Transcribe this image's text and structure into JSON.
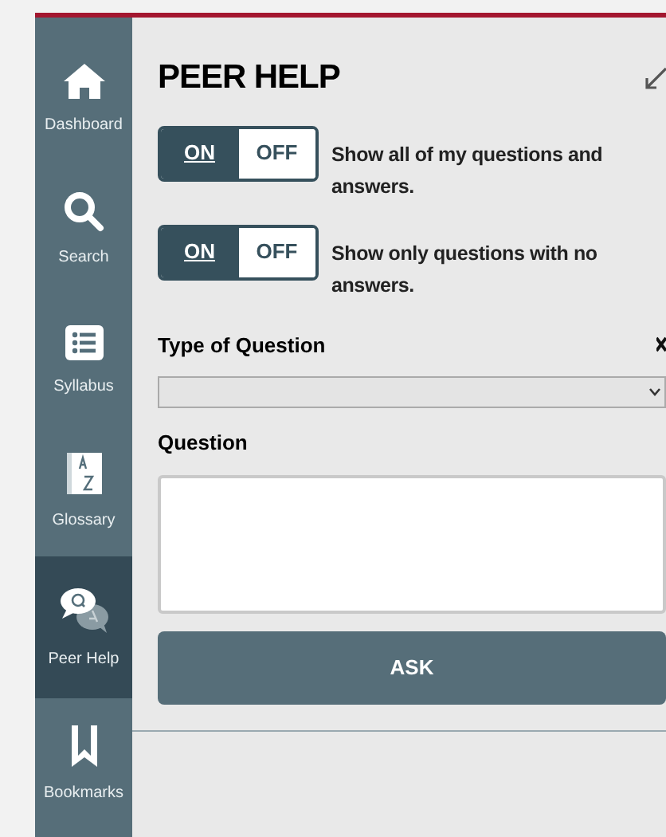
{
  "sidebar": {
    "items": [
      {
        "label": "Dashboard",
        "selected": false
      },
      {
        "label": "Search",
        "selected": false
      },
      {
        "label": "Syllabus",
        "selected": false
      },
      {
        "label": "Glossary",
        "selected": false
      },
      {
        "label": "Peer Help",
        "selected": true
      },
      {
        "label": "Bookmarks",
        "selected": false
      }
    ]
  },
  "title": "PEER HELP",
  "filters": [
    {
      "options": [
        {
          "label": "ON",
          "selected": true
        },
        {
          "label": "OFF",
          "selected": false
        }
      ],
      "text": "Show all of my questions and answers."
    },
    {
      "options": [
        {
          "label": "ON",
          "selected": true
        },
        {
          "label": "OFF",
          "selected": false
        }
      ],
      "text": "Show only questions with no answers."
    }
  ],
  "type_label": "Type of Question",
  "question_label": "Question",
  "ask_button": "ASK"
}
